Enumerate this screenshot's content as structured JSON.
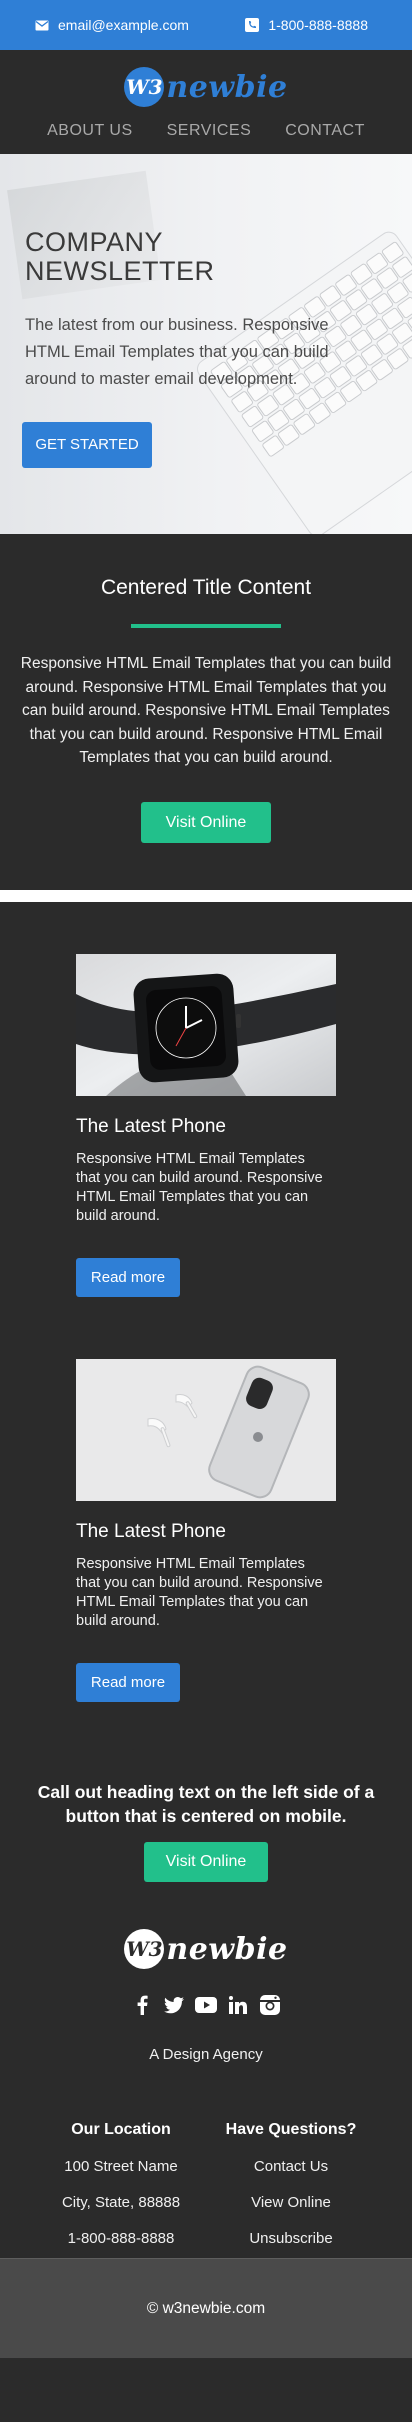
{
  "topbar": {
    "email": "email@example.com",
    "phone": "1-800-888-8888"
  },
  "brand": {
    "mark": "W3",
    "name": "newbie"
  },
  "nav": [
    "ABOUT US",
    "SERVICES",
    "CONTACT"
  ],
  "hero": {
    "title": "COMPANY NEWSLETTER",
    "text": "The latest from our business. Responsive HTML Email Templates that you can build around to master email development.",
    "button": "GET STARTED"
  },
  "centered": {
    "title": "Centered Title Content",
    "text": "Responsive HTML Email Templates that you can build around. Responsive HTML Email Templates that you can build around. Responsive HTML Email Templates that you can build around. Responsive HTML Email Templates that you can build around.",
    "button": "Visit Online"
  },
  "cards": [
    {
      "image": "smartwatch",
      "title": "The Latest Phone",
      "text": "Responsive HTML Email Templates that you can build around. Responsive HTML Email Templates that you can build around.",
      "button": "Read more"
    },
    {
      "image": "phone and earbuds",
      "title": "The Latest Phone",
      "text": "Responsive HTML Email Templates that you can build around. Responsive HTML Email Templates that you can build around.",
      "button": "Read more"
    }
  ],
  "callout": {
    "heading": "Call out heading text on the left side of a button that is centered on mobile.",
    "button": "Visit Online"
  },
  "footer": {
    "brand": {
      "mark": "W3",
      "name": "newbie"
    },
    "social_icons": [
      "facebook-icon",
      "twitter-icon",
      "youtube-icon",
      "linkedin-icon",
      "instagram-icon"
    ],
    "tagline": "A Design Agency",
    "location": {
      "title": "Our Location",
      "lines": [
        "100 Street Name",
        "City, State, 88888",
        "1-800-888-8888"
      ]
    },
    "questions": {
      "title": "Have Questions?",
      "links": [
        "Contact Us",
        "View Online",
        "Unsubscribe"
      ]
    },
    "copyright": "© w3newbie.com"
  },
  "colors": {
    "blue": "#2f7fd6",
    "green": "#22c08b",
    "dark": "#2b2b2b"
  }
}
